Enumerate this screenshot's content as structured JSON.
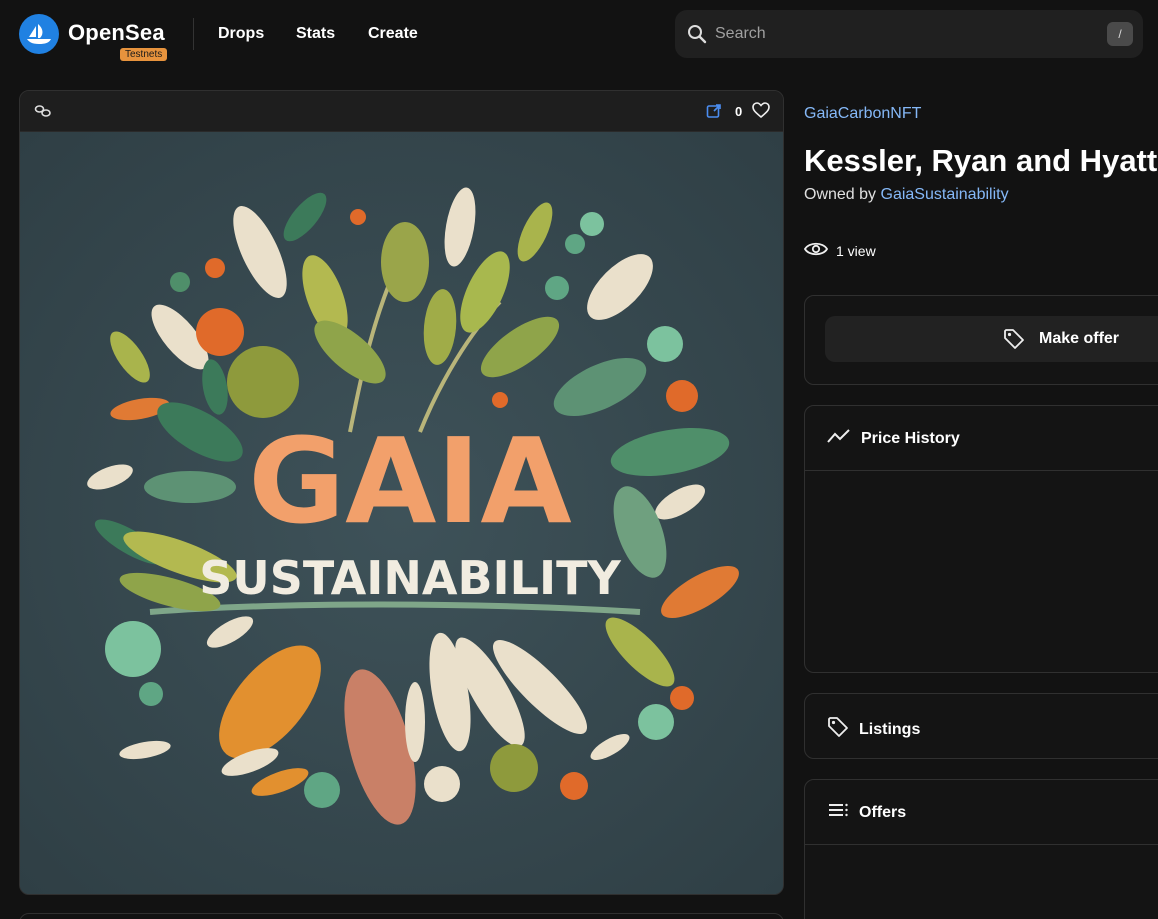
{
  "header": {
    "brand": "OpenSea",
    "badge": "Testnets",
    "nav": [
      "Drops",
      "Stats",
      "Create"
    ],
    "search_placeholder": "Search",
    "search_shortcut": "/"
  },
  "item": {
    "like_count": "0",
    "art_title": "GAIA",
    "art_subtitle": "SUSTAINABILITY",
    "collection": "GaiaCarbonNFT",
    "name": "Kessler, Ryan and Hyatt",
    "owned_by_label": "Owned by",
    "owner": "GaiaSustainability",
    "views": "1 view"
  },
  "actions": {
    "make_offer": "Make offer"
  },
  "sections": {
    "price_history": "Price History",
    "listings": "Listings",
    "offers": "Offers"
  },
  "colors": {
    "background": "#121212",
    "accent_blue": "#2081e2",
    "link": "#85b8f7",
    "badge": "#e7933d"
  }
}
